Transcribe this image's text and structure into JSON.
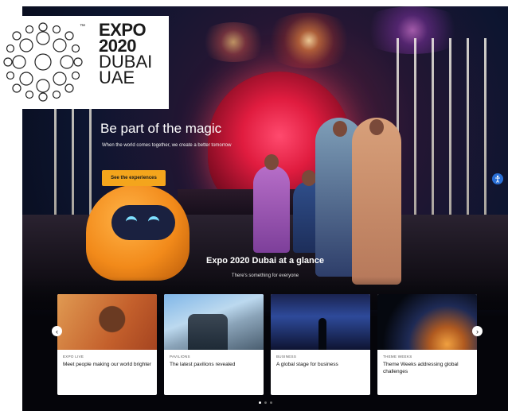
{
  "logo": {
    "tm": "™",
    "line1": "EXPO",
    "line2": "2020",
    "line3": "DUBAI",
    "line4": "UAE",
    "icon": "expo-ring-logo"
  },
  "hero": {
    "title": "Be part of the magic",
    "subtitle": "When the world comes together, we create a better tomorrow",
    "cta_label": "See the experiences"
  },
  "side_badge_icon": "accessibility-icon",
  "glance": {
    "title": "Expo 2020 Dubai at a glance",
    "subtitle": "There's something for everyone"
  },
  "cards": [
    {
      "tag": "EXPO LIVE",
      "title": "Meet people making our world brighter"
    },
    {
      "tag": "PAVILIONS",
      "title": "The latest pavilions revealed"
    },
    {
      "tag": "BUSINESS",
      "title": "A global stage for business"
    },
    {
      "tag": "THEME WEEKS",
      "title": "Theme Weeks addressing global challenges"
    }
  ],
  "carousel": {
    "prev_icon": "chevron-left-icon",
    "next_icon": "chevron-right-icon",
    "prev_glyph": "‹",
    "next_glyph": "›",
    "page_count": 3,
    "active_page": 1
  },
  "colors": {
    "cta": "#f4a51c",
    "dome": "#e01c3f"
  }
}
